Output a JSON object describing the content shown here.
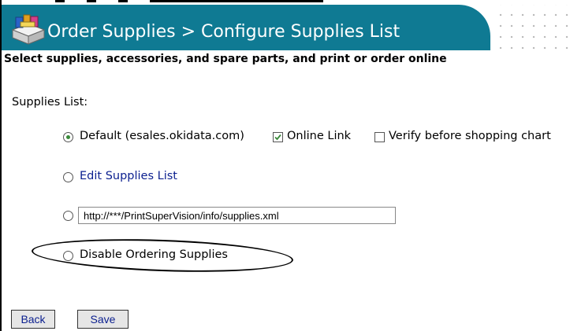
{
  "header": {
    "title": "Order Supplies > Configure Supplies List",
    "icon": "supplies-box-icon"
  },
  "subtitle": "Select supplies, accessories, and spare parts, and print or order online",
  "section_label": "Supplies List:",
  "options": {
    "default": {
      "label": "Default (esales.okidata.com)",
      "selected": true,
      "online_link": {
        "label": "Online Link",
        "checked": true
      },
      "verify": {
        "label": "Verify before shopping chart",
        "checked": false
      }
    },
    "edit": {
      "label": "Edit Supplies List",
      "selected": false
    },
    "custom_url": {
      "value": "http://***/PrintSuperVision/info/supplies.xml",
      "selected": false
    },
    "disable": {
      "label": "Disable Ordering Supplies",
      "selected": false
    }
  },
  "buttons": {
    "back": "Back",
    "save": "Save"
  },
  "colors": {
    "header_bg": "#0f7a93",
    "link": "#0b1f8f",
    "radio_dot": "#3a8a3a"
  }
}
